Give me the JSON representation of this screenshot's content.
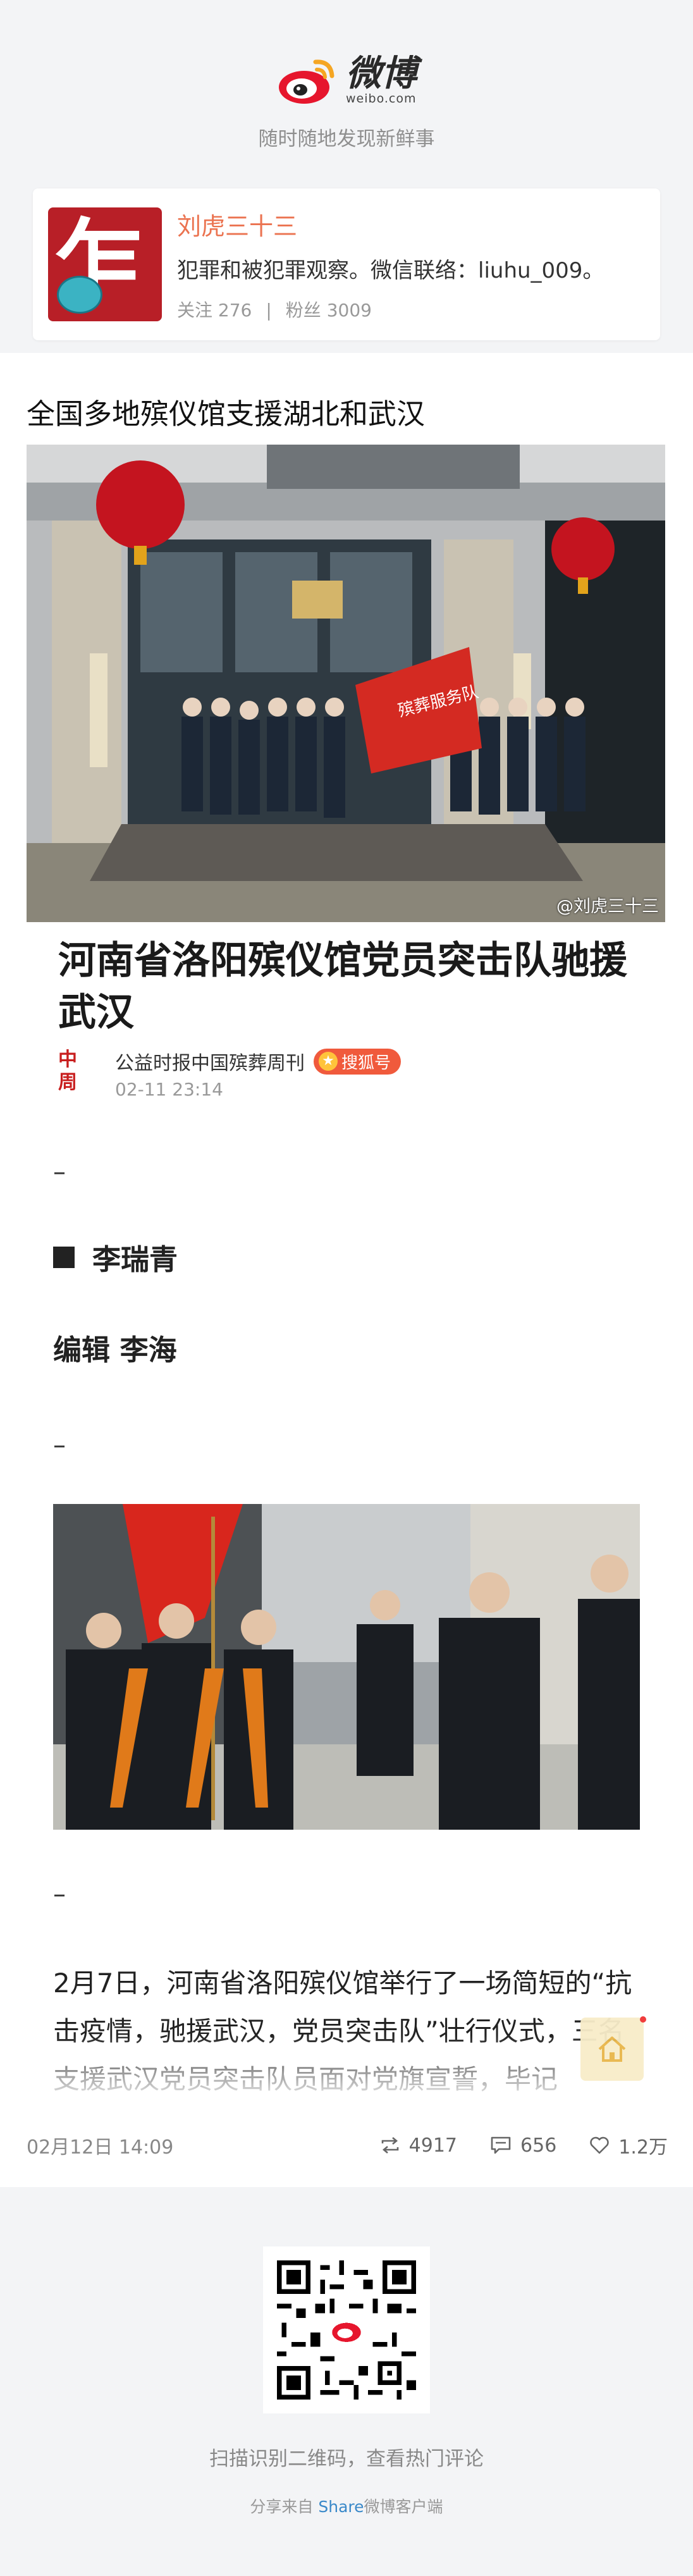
{
  "header": {
    "logo_cn": "微博",
    "logo_url": "weibo.com",
    "tagline": "随时随地发现新鲜事"
  },
  "profile": {
    "name": "刘虎三十三",
    "bio": "犯罪和被犯罪观察。微信联络：liuhu_009。",
    "following_label": "关注 276",
    "followers_label": "粉丝 3009",
    "separator": "|"
  },
  "post": {
    "title": "全国多地殡仪馆支援湖北和武汉",
    "photo1_watermark": "@刘虎三十三",
    "article_title": "河南省洛阳殡仪馆党员突击队驰援武汉",
    "source_name": "公益时报中国殡葬周刊",
    "source_badge": "搜狐号",
    "source_date": "02-11 23:14",
    "dash": "–",
    "author": "李瑞青",
    "editor": "编辑 李海",
    "paragraph": "2月7日，河南省洛阳殡仪馆举行了一场简短的“抗击疫情，驰援武汉，党员突击队”壮行仪式，三名支援武汉党员突击队员面对党旗宣誓，毕记"
  },
  "meta": {
    "date": "02月12日 14:09",
    "reposts": "4917",
    "comments": "656",
    "likes": "1.2万"
  },
  "footer": {
    "qr_caption": "扫描识别二维码，查看热门评论",
    "share_prefix": "分享来自",
    "share_link": "Share",
    "share_suffix": "微博客户端"
  },
  "colors": {
    "accent_orange": "#eb7350",
    "page_bg": "#f3f4f6",
    "link_blue": "#3a89c9",
    "badge_red": "#f05a3c"
  },
  "icons": [
    "weibo-logo-icon",
    "repost-icon",
    "comment-icon",
    "like-icon",
    "home-icon",
    "qr-code-icon",
    "star-icon"
  ]
}
